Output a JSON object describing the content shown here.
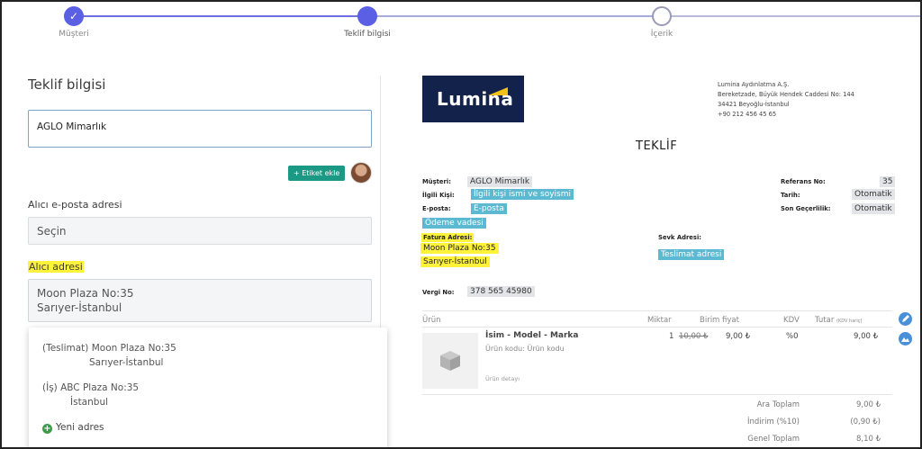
{
  "stepper": {
    "steps": [
      {
        "label": "Müşteri",
        "state": "done"
      },
      {
        "label": "Teklif bilgisi",
        "state": "current"
      },
      {
        "label": "İçerik",
        "state": "todo"
      }
    ],
    "check_glyph": "✓"
  },
  "form": {
    "title": "Teklif bilgisi",
    "company_value": "AGLO Mimarlık",
    "tag_button": "+ Etiket ekle",
    "email_label": "Alıcı e-posta adresi",
    "email_placeholder": "Seçin",
    "address_label": "Alıcı adresi",
    "address_line1": "Moon Plaza No:35",
    "address_line2": "Sarıyer-İstanbul",
    "address_options": [
      {
        "line1": "(Teslimat) Moon Plaza No:35",
        "line2": "Sarıyer-İstanbul"
      },
      {
        "line1": "(İş) ABC Plaza No:35",
        "line2": "İstanbul"
      }
    ],
    "new_address": "Yeni adres",
    "new_address_icon": "+"
  },
  "preview": {
    "logo_text": "Lumina",
    "company_lines": [
      "Lumina Aydınlatma A.Ş.",
      "Bereketzade, Büyük Hendek Caddesi No: 144",
      "34421 Beyoğlu-İstanbul",
      "+90 212 456 45 65"
    ],
    "doc_title": "TEKLİF",
    "fields": {
      "musteri_label": "Müşteri:",
      "musteri_value": "AGLO Mimarlık",
      "ilgili_label": "İlgili Kişi:",
      "ilgili_value": "İlgili kişi ismi ve soyismi",
      "eposta_label": "E-posta:",
      "eposta_value": "E-posta",
      "odeme_value": "Ödeme vadesi",
      "fatura_label": "Fatura Adresi:",
      "fatura_line1": "Moon Plaza No:35",
      "fatura_line2": "Sarıyer-İstanbul",
      "sevk_label": "Sevk Adresi:",
      "teslimat_value": "Teslimat adresi",
      "vergi_label": "Vergi No:",
      "vergi_value": "378 565 45980",
      "referans_label": "Referans No:",
      "referans_value": "35",
      "tarih_label": "Tarih:",
      "tarih_value": "Otomatik",
      "son_label": "Son Geçerlilik:",
      "son_value": "Otomatik"
    },
    "table": {
      "headers": {
        "urun": "Ürün",
        "miktar": "Miktar",
        "birim": "Birim fiyat",
        "kdv": "KDV",
        "tutar": "Tutar",
        "tutar_note": "(KDV hariç)"
      },
      "row": {
        "name": "İsim - Model - Marka",
        "code": "Ürün kodu: Ürün kodu",
        "detail": "Ürün detayı",
        "qty": "1",
        "old_price": "10,00 ₺",
        "price": "9,00 ₺",
        "kdv": "%0",
        "total": "9,00 ₺"
      }
    },
    "totals": [
      {
        "label": "Ara Toplam",
        "value": "9,00 ₺"
      },
      {
        "label": "İndirim (%10)",
        "value": "(0,90 ₺)"
      },
      {
        "label": "Genel Toplam",
        "value": "8,10 ₺"
      }
    ]
  }
}
